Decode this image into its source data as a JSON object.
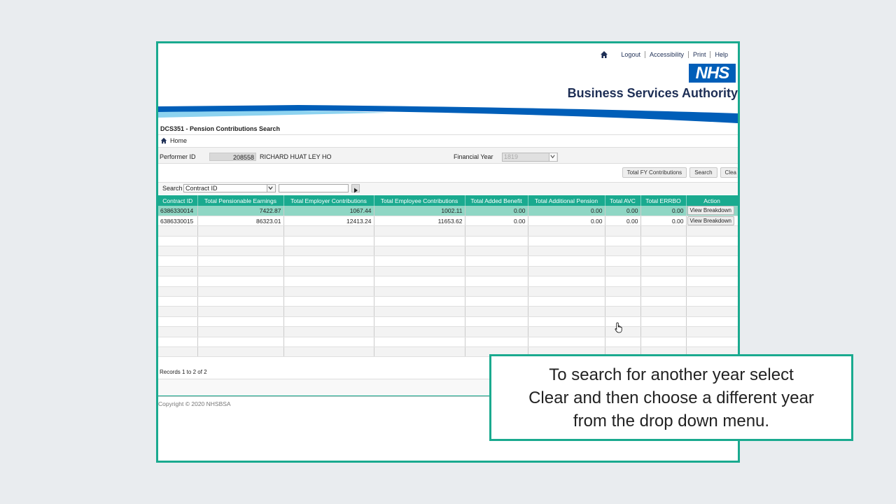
{
  "topnav": {
    "links": [
      "Logout",
      "Accessibility",
      "Print",
      "Help"
    ]
  },
  "brand": {
    "logo_text": "NHS",
    "org_name": "Business Services Authority",
    "color": "#005eb8",
    "accent": "#1aaa8f"
  },
  "page": {
    "title": "DCS351 - Pension Contributions Search",
    "breadcrumb": "Home"
  },
  "performer": {
    "label": "Performer ID",
    "id": "208558",
    "name": "RICHARD HUAT LEY HO"
  },
  "financial_year": {
    "label": "Financial Year",
    "value": "1819"
  },
  "buttons": {
    "total_fy": "Total FY Contributions",
    "search": "Search",
    "clear": "Clea"
  },
  "search": {
    "label": "Search",
    "field": "Contract ID",
    "value": ""
  },
  "table": {
    "columns": [
      "Contract ID",
      "Total Pensionable Earnings",
      "Total Employer Contributions",
      "Total Employee Contributions",
      "Total Added Benefit",
      "Total Additional Pension",
      "Total AVC",
      "Total ERRBO",
      "Action"
    ],
    "rows": [
      [
        "6386330014",
        "7422.87",
        "1067.44",
        "1002.11",
        "0.00",
        "0.00",
        "0.00",
        "0.00",
        "View Breakdown"
      ],
      [
        "6386330015",
        "86323.01",
        "12413.24",
        "11653.62",
        "0.00",
        "0.00",
        "0.00",
        "0.00",
        "View Breakdown"
      ]
    ],
    "empty_rows": 13
  },
  "records": "Records 1 to 2 of 2",
  "copyright": "Copyright © 2020 NHSBSA",
  "caption": {
    "line1": "To search for another year select",
    "line2": "Clear and then choose a different year",
    "line3": "from the drop down menu."
  }
}
